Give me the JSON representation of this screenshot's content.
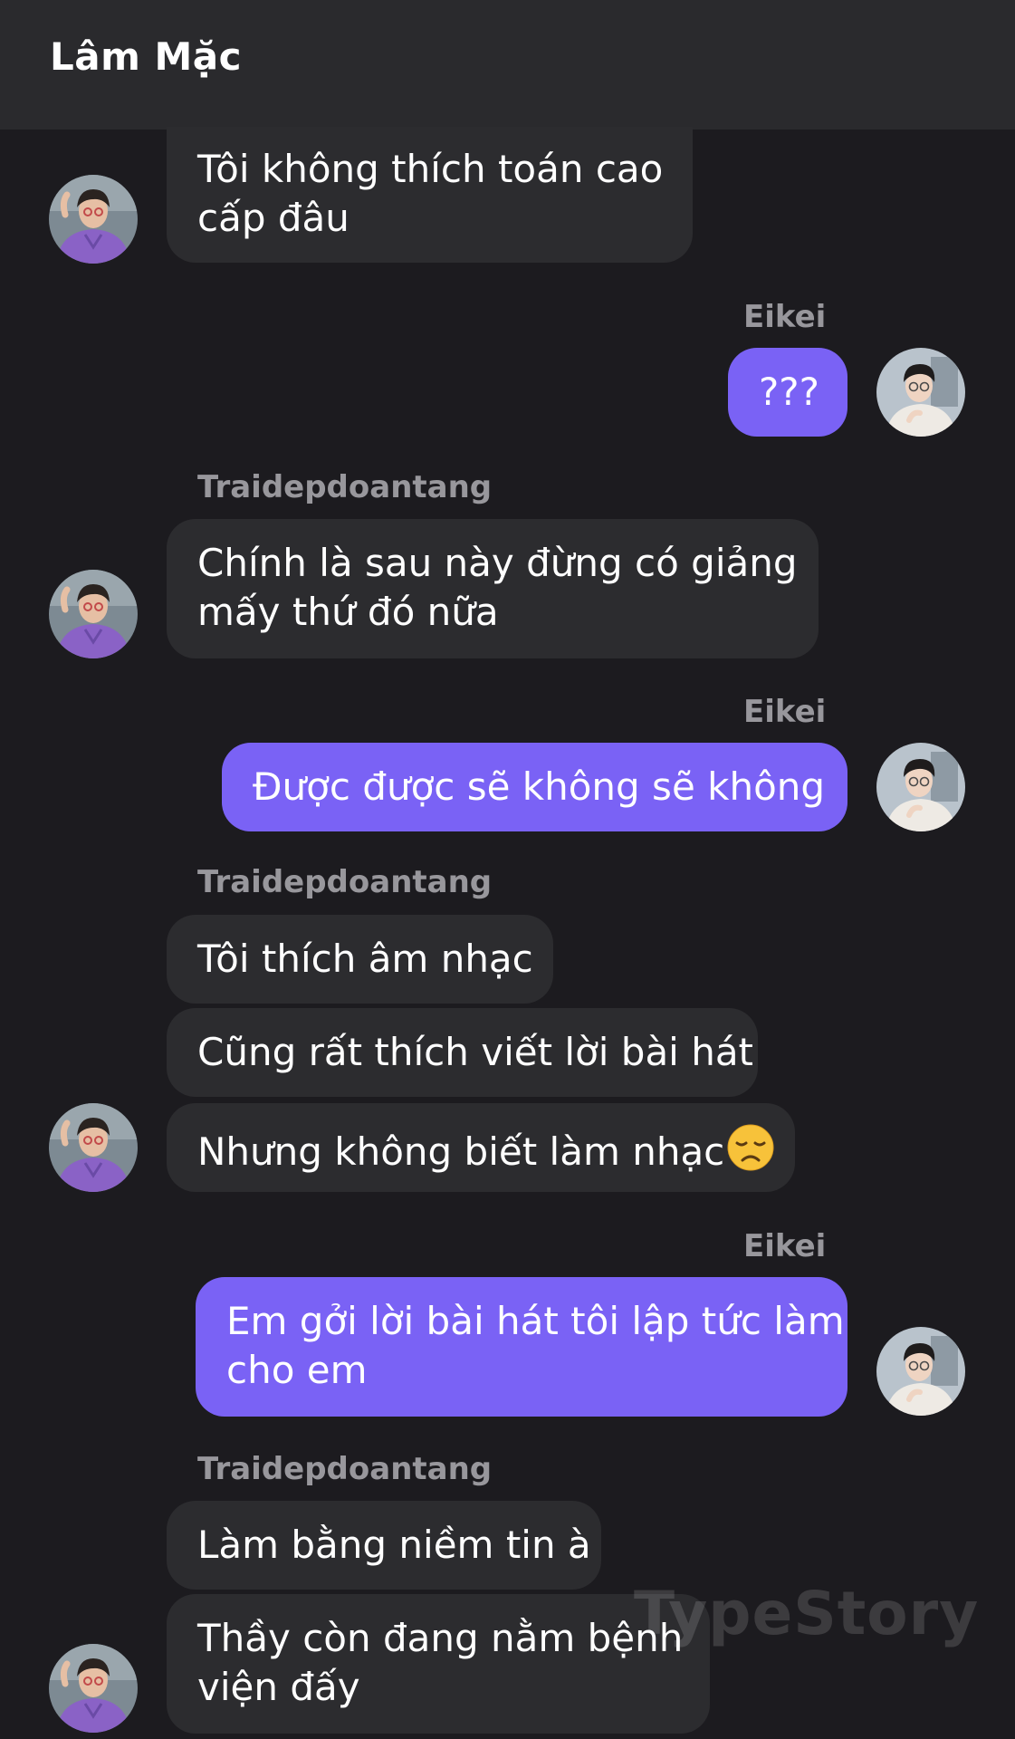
{
  "header": {
    "title": "Lâm Mặc"
  },
  "participants": {
    "other": {
      "name": "Traidepdoantang",
      "avatar_icon": "avatar-purple-shirt"
    },
    "self": {
      "name": "Eikei",
      "avatar_icon": "avatar-white-shirt"
    }
  },
  "colors": {
    "background": "#1c1b1f",
    "header": "#2a2a2d",
    "incoming_bubble": "#2c2c2f",
    "outgoing_bubble": "#7a62f5",
    "sender_name": "#98979c"
  },
  "messages": {
    "m1": {
      "line1": "Tôi không thích toán cao",
      "line2": "cấp đâu"
    },
    "name2": "Eikei",
    "m2": {
      "text": "???"
    },
    "name3": "Traidepdoantang",
    "m3": {
      "line1": "Chính là sau này đừng có giảng",
      "line2": "mấy thứ đó nữa"
    },
    "name4": "Eikei",
    "m4": {
      "text": "Được được sẽ không sẽ không"
    },
    "name5": "Traidepdoantang",
    "m5": {
      "text": "Tôi thích âm nhạc"
    },
    "m6": {
      "text": "Cũng rất thích viết lời bài hát"
    },
    "m7": {
      "text": "Nhưng không biết làm nhạc",
      "emoji": "disappointed-face-icon"
    },
    "name8": "Eikei",
    "m8": {
      "line1": "Em gởi lời bài hát tôi lập tức làm",
      "line2": "cho em"
    },
    "name9": "Traidepdoantang",
    "m9": {
      "text": "Làm bằng niềm tin à"
    },
    "m10": {
      "line1": "Thầy còn đang nằm bệnh",
      "line2": "viện đấy"
    }
  },
  "watermark": {
    "text": "TypeStory"
  }
}
